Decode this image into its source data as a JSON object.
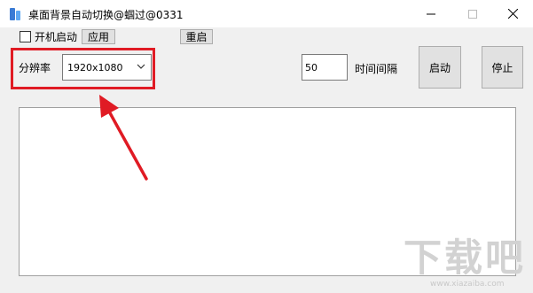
{
  "window": {
    "title": "桌面背景自动切换@蝈过@0331",
    "icon": "app-icon",
    "controls": [
      "minimize-icon",
      "maximize-icon",
      "close-icon"
    ]
  },
  "options": {
    "autostart_label": "开机启动",
    "autostart_checked": false,
    "apply_label": "应用",
    "restart_label": "重启"
  },
  "resolution": {
    "label": "分辨率",
    "value": "1920x1080"
  },
  "interval": {
    "value": "50",
    "label": "时间间隔"
  },
  "actions": {
    "start_label": "启动",
    "stop_label": "停止"
  },
  "log": {
    "text": ""
  },
  "annotation": {
    "highlight_color": "#e01b24"
  },
  "watermark": {
    "text": "下载吧",
    "url": "www.xiazaiba.com"
  }
}
